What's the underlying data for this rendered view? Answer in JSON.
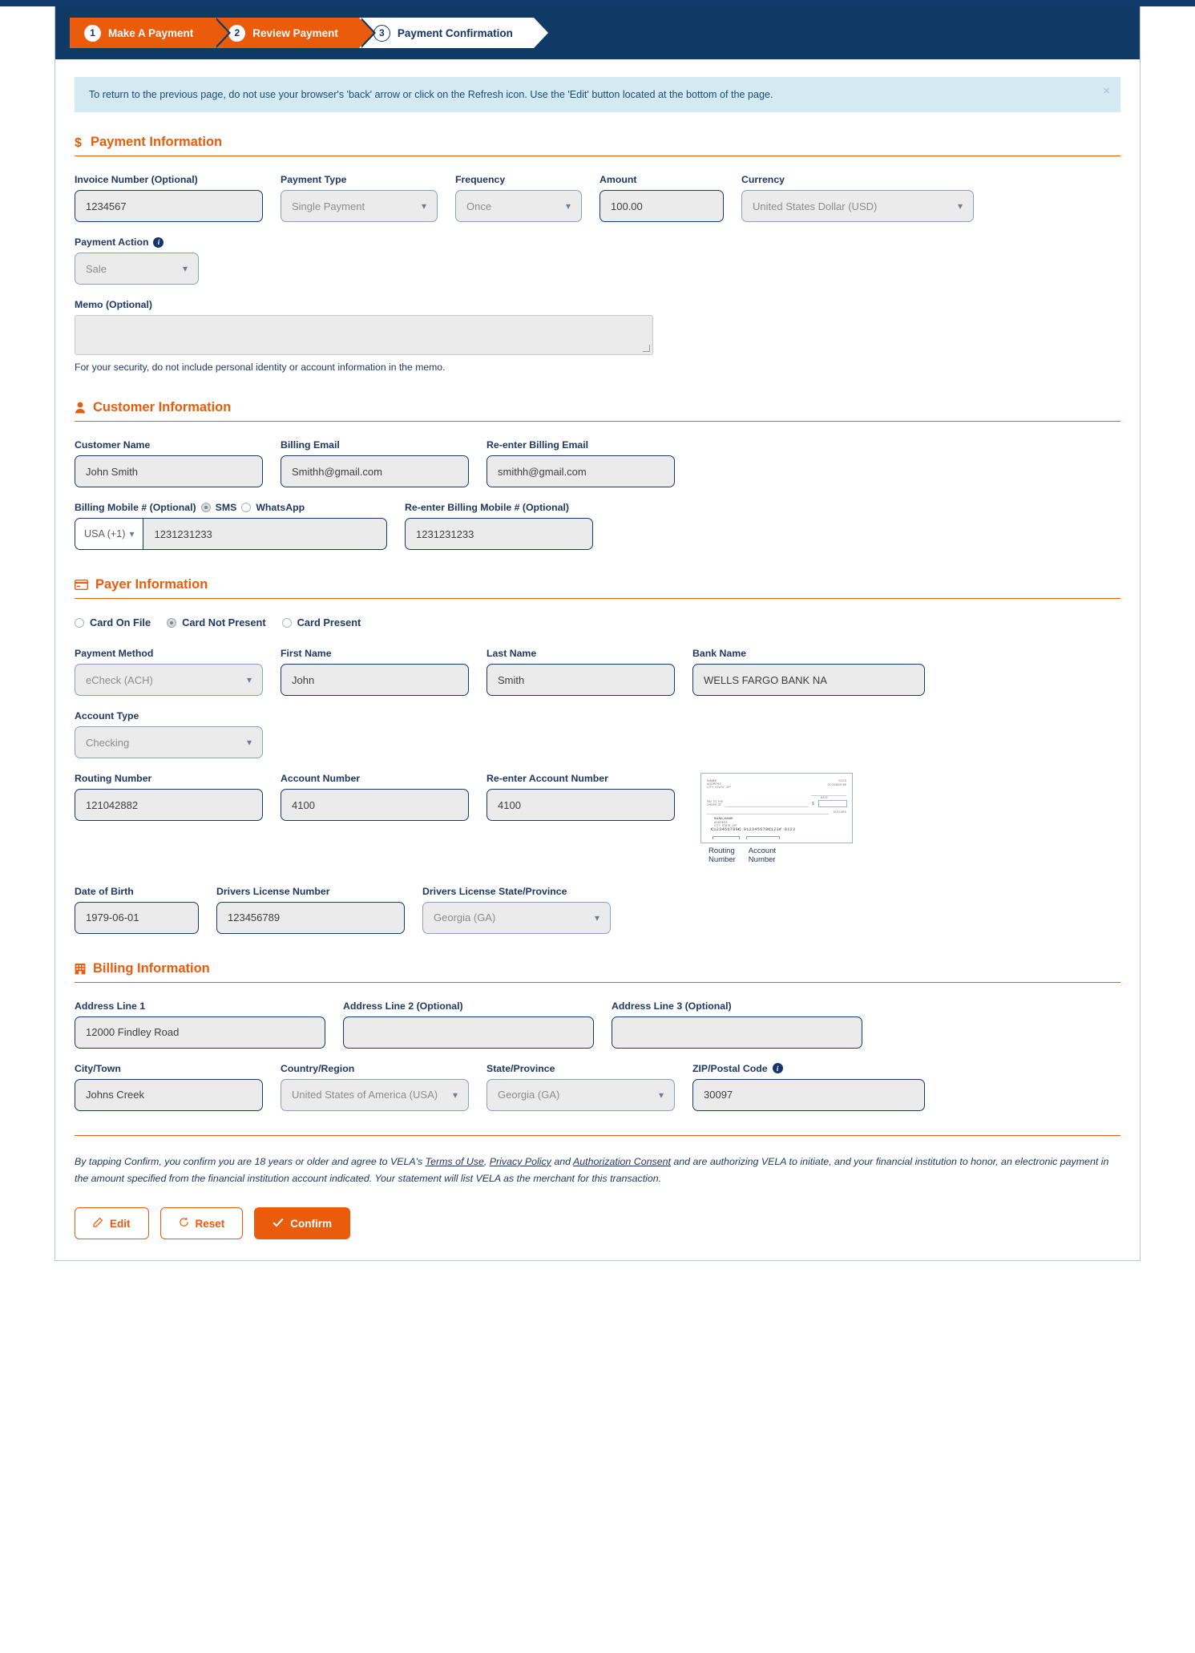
{
  "wizard": {
    "steps": [
      {
        "num": "1",
        "label": "Make A Payment",
        "state": "active"
      },
      {
        "num": "2",
        "label": "Review Payment",
        "state": "active"
      },
      {
        "num": "3",
        "label": "Payment Confirmation",
        "state": "current"
      }
    ]
  },
  "alert": {
    "text": "To return to the previous page, do not use your browser's 'back' arrow or click on the Refresh icon. Use the 'Edit' button located at the bottom of the page.",
    "close": "×"
  },
  "payment_information": {
    "heading": "Payment Information",
    "icon": "dollar-icon",
    "invoice_label": "Invoice Number (Optional)",
    "invoice_value": "1234567",
    "payment_type_label": "Payment Type",
    "payment_type_value": "Single Payment",
    "frequency_label": "Frequency",
    "frequency_value": "Once",
    "amount_label": "Amount",
    "amount_value": "100.00",
    "currency_label": "Currency",
    "currency_value": "United States Dollar (USD)",
    "payment_action_label": "Payment Action",
    "payment_action_value": "Sale",
    "memo_label": "Memo (Optional)",
    "memo_value": "",
    "memo_hint": "For your security, do not include personal identity or account information in the memo."
  },
  "customer_information": {
    "heading": "Customer Information",
    "icon": "person-icon",
    "customer_name_label": "Customer Name",
    "customer_name_value": "John Smith",
    "billing_email_label": "Billing Email",
    "billing_email_value": "Smithh@gmail.com",
    "reenter_email_label": "Re-enter Billing Email",
    "reenter_email_value": "smithh@gmail.com",
    "mobile_label": "Billing Mobile # (Optional)",
    "sms_label": "SMS",
    "whatsapp_label": "WhatsApp",
    "selected_channel": "SMS",
    "country_code": "USA (+1)",
    "mobile_value": "1231231233",
    "reenter_mobile_label": "Re-enter Billing Mobile # (Optional)",
    "reenter_mobile_value": "1231231233"
  },
  "payer_information": {
    "heading": "Payer Information",
    "icon": "credit-card-icon",
    "card_options": [
      "Card On File",
      "Card Not Present",
      "Card Present"
    ],
    "selected_card_option": "Card Not Present",
    "payment_method_label": "Payment Method",
    "payment_method_value": "eCheck (ACH)",
    "first_name_label": "First Name",
    "first_name_value": "John",
    "last_name_label": "Last Name",
    "last_name_value": "Smith",
    "bank_name_label": "Bank Name",
    "bank_name_value": "WELLS FARGO BANK NA",
    "account_type_label": "Account Type",
    "account_type_value": "Checking",
    "routing_label": "Routing Number",
    "routing_value": "121042882",
    "account_label": "Account Number",
    "account_value": "4100",
    "reenter_account_label": "Re-enter Account Number",
    "reenter_account_value": "4100",
    "check_caption_routing": "Routing\nNumber",
    "check_caption_account": "Account\nNumber",
    "check_micr": "⑆123456789⑆ 012345678⑆123⑈ 0123",
    "dob_label": "Date of Birth",
    "dob_value": "1979-06-01",
    "dl_number_label": "Drivers License Number",
    "dl_number_value": "123456789",
    "dl_state_label": "Drivers License State/Province",
    "dl_state_value": "Georgia (GA)"
  },
  "billing_information": {
    "heading": "Billing Information",
    "icon": "building-icon",
    "address1_label": "Address Line 1",
    "address1_value": "12000 Findley Road",
    "address2_label": "Address Line 2 (Optional)",
    "address2_value": "",
    "address3_label": "Address Line 3 (Optional)",
    "address3_value": "",
    "city_label": "City/Town",
    "city_value": "Johns Creek",
    "country_label": "Country/Region",
    "country_value": "United States of America (USA)",
    "state_label": "State/Province",
    "state_value": "Georgia (GA)",
    "zip_label": "ZIP/Postal Code",
    "zip_value": "30097"
  },
  "legal": {
    "part1": "By tapping Confirm, you confirm you are 18 years or older and agree to VELA's ",
    "link_terms": "Terms of Use",
    "sep1": ", ",
    "link_privacy": "Privacy Policy",
    "sep2": " and ",
    "link_auth": "Authorization Consent",
    "part2": " and are authorizing VELA to initiate, and your financial institution to honor, an electronic payment in the amount specified from the financial institution account indicated. Your statement will list VELA as the merchant for this transaction."
  },
  "buttons": {
    "edit": "Edit",
    "reset": "Reset",
    "confirm": "Confirm"
  }
}
